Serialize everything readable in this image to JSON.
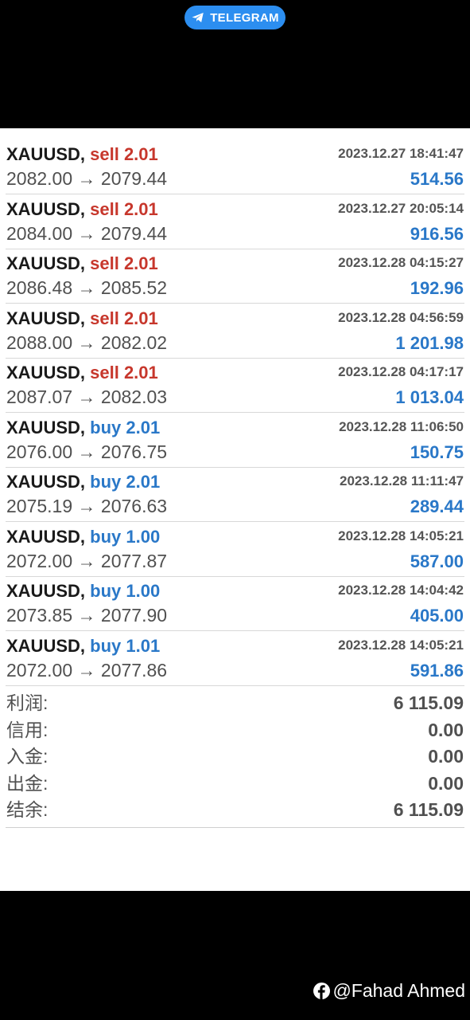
{
  "badge": {
    "label": "TELEGRAM",
    "icon": "telegram-plane-icon",
    "color": "#2c8ef0"
  },
  "colors": {
    "sell": "#c7372c",
    "buy": "#2a78c8",
    "profit": "#2a78c8"
  },
  "trades": [
    {
      "symbol": "XAUUSD,",
      "side_volume": "sell 2.01",
      "side": "sell",
      "time": "2023.12.27 18:41:47",
      "prices": "2082.00 → 2079.44",
      "profit": "514.56"
    },
    {
      "symbol": "XAUUSD,",
      "side_volume": "sell 2.01",
      "side": "sell",
      "time": "2023.12.27 20:05:14",
      "prices": "2084.00 → 2079.44",
      "profit": "916.56"
    },
    {
      "symbol": "XAUUSD,",
      "side_volume": "sell 2.01",
      "side": "sell",
      "time": "2023.12.28 04:15:27",
      "prices": "2086.48 → 2085.52",
      "profit": "192.96"
    },
    {
      "symbol": "XAUUSD,",
      "side_volume": "sell 2.01",
      "side": "sell",
      "time": "2023.12.28 04:56:59",
      "prices": "2088.00 → 2082.02",
      "profit": "1 201.98"
    },
    {
      "symbol": "XAUUSD,",
      "side_volume": "sell 2.01",
      "side": "sell",
      "time": "2023.12.28 04:17:17",
      "prices": "2087.07 → 2082.03",
      "profit": "1 013.04"
    },
    {
      "symbol": "XAUUSD,",
      "side_volume": "buy 2.01",
      "side": "buy",
      "time": "2023.12.28 11:06:50",
      "prices": "2076.00 → 2076.75",
      "profit": "150.75"
    },
    {
      "symbol": "XAUUSD,",
      "side_volume": "buy 2.01",
      "side": "buy",
      "time": "2023.12.28 11:11:47",
      "prices": "2075.19 → 2076.63",
      "profit": "289.44"
    },
    {
      "symbol": "XAUUSD,",
      "side_volume": "buy 1.00",
      "side": "buy",
      "time": "2023.12.28 14:05:21",
      "prices": "2072.00 → 2077.87",
      "profit": "587.00"
    },
    {
      "symbol": "XAUUSD,",
      "side_volume": "buy 1.00",
      "side": "buy",
      "time": "2023.12.28 14:04:42",
      "prices": "2073.85 → 2077.90",
      "profit": "405.00"
    },
    {
      "symbol": "XAUUSD,",
      "side_volume": "buy 1.01",
      "side": "buy",
      "time": "2023.12.28 14:05:21",
      "prices": "2072.00 → 2077.86",
      "profit": "591.86"
    }
  ],
  "summary": [
    {
      "label": "利润:",
      "value": "6 115.09"
    },
    {
      "label": "信用:",
      "value": "0.00"
    },
    {
      "label": "入金:",
      "value": "0.00"
    },
    {
      "label": "出金:",
      "value": "0.00"
    },
    {
      "label": "结余:",
      "value": "6 115.09"
    }
  ],
  "credit": {
    "handle": "@Fahad Ahmed",
    "icon": "facebook-icon"
  }
}
